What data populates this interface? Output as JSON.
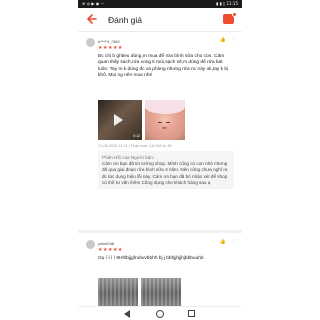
{
  "status_bar": {
    "left": "≋ ◎ ▶ ◉ ···",
    "right": "▮ ▮ ▯ 11:15"
  },
  "header": {
    "title": "Đánh giá"
  },
  "review_1": {
    "username": "h*****t_*369",
    "stars": "★★★★★",
    "text": "Bc chị b ghtieu dùng,m mua để rửa bình sữa cho con. Cảm quan thấy sach,rửa xong k mùi,sạch sẽ,m dùng để rửa bát luôn. Tay m k dùng đc xà phòng nhưng rửa nc này ok,tay k bị khô. Mọi ng nên mua nhé",
    "meta": "21-08-2020 11:31 | Phân loại: Cái 300 m..Bị",
    "video_duration": "0:12",
    "reply": {
      "title": "Phản Hồi của Người bán:",
      "text": "Cảm ơn bạn đã tin tưởng shop. Mình cũng có con nhỏ nhưng đã qua giai đoạn rửa bình sữa 3 năm. Nên cũng chưa nghĩ ra đc tác dụng hiệu lỗi này. Cảm ơn bạn đã bỏ nhận xét để shop có thể tư vấn thêm Cũng dụng cho khách hàng sau ạ"
    }
  },
  "review_2": {
    "username": "yokei246",
    "stars": "★★★★★",
    "text": "Gụ ì ì ì ì 9Hhlbjjgfrubvvbbhh bj j bbhjjhjjhjbbbuuhb"
  },
  "icons": {
    "back": "arrow-left",
    "chat": "chat",
    "like": "thumbs-up",
    "more": "more-vertical"
  },
  "colors": {
    "accent": "#ee4d2d"
  }
}
